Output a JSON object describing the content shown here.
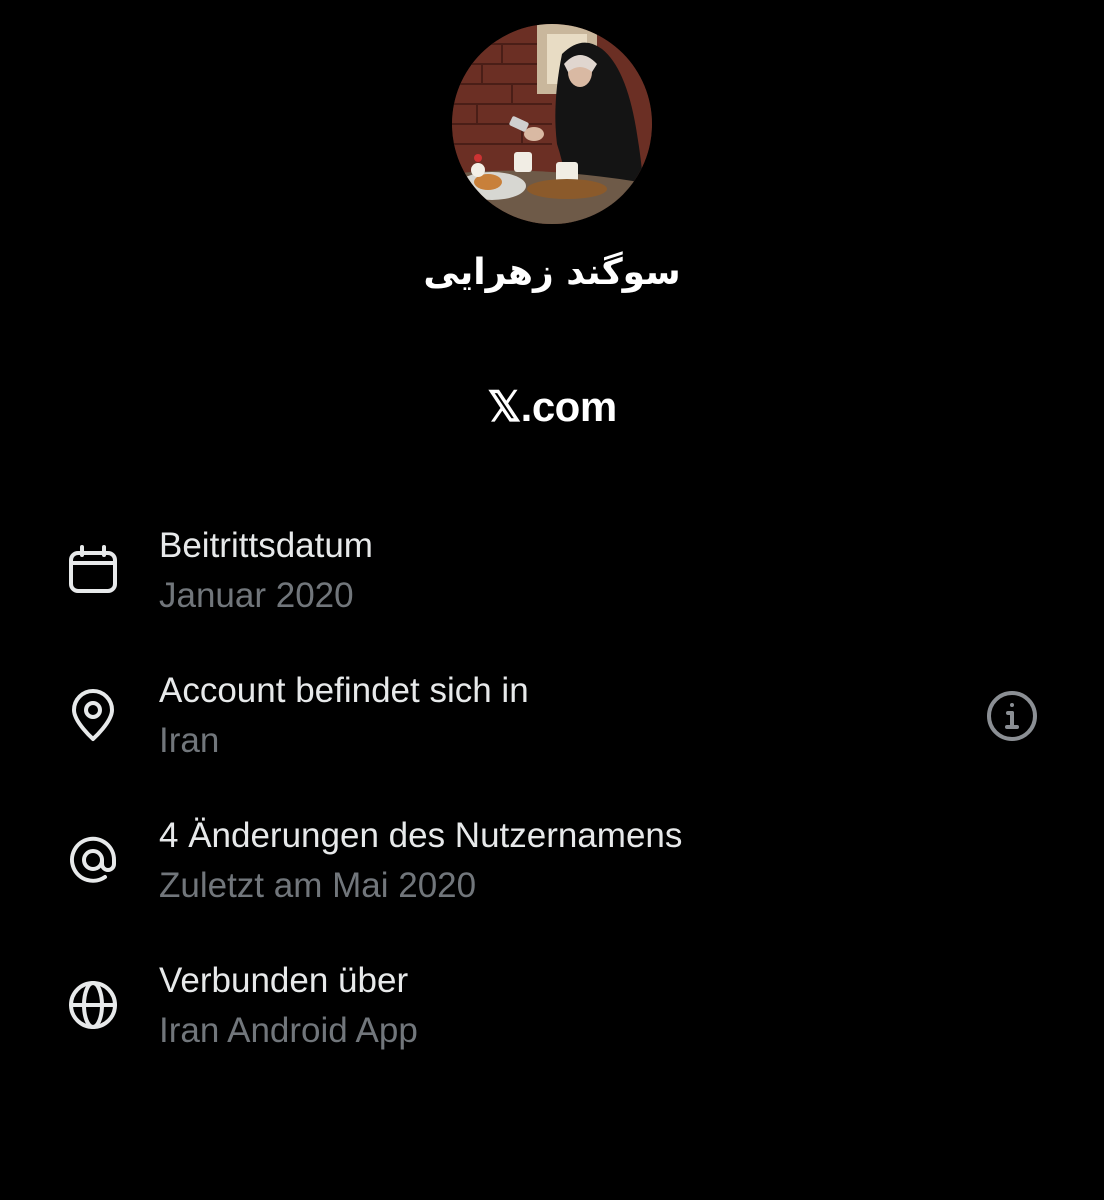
{
  "profile": {
    "display_name": "سوگند زهرایی",
    "avatar_alt": "profile-photo"
  },
  "brand": {
    "logo_glyph": "𝕏",
    "domain_suffix": ".com"
  },
  "details": [
    {
      "icon": "calendar-icon",
      "title": "Beitrittsdatum",
      "value": "Januar 2020"
    },
    {
      "icon": "location-pin-icon",
      "title": "Account befindet sich in",
      "value": "Iran",
      "has_info": true
    },
    {
      "icon": "at-sign-icon",
      "title": "4 Änderungen des Nutzernamens",
      "value": "Zuletzt am Mai 2020"
    },
    {
      "icon": "globe-icon",
      "title": "Verbunden über",
      "value": "Iran Android App"
    }
  ],
  "colors": {
    "background": "#000000",
    "primary_text": "#e7e9ea",
    "secondary_text": "#71767b",
    "info_icon": "#8b8f94"
  }
}
